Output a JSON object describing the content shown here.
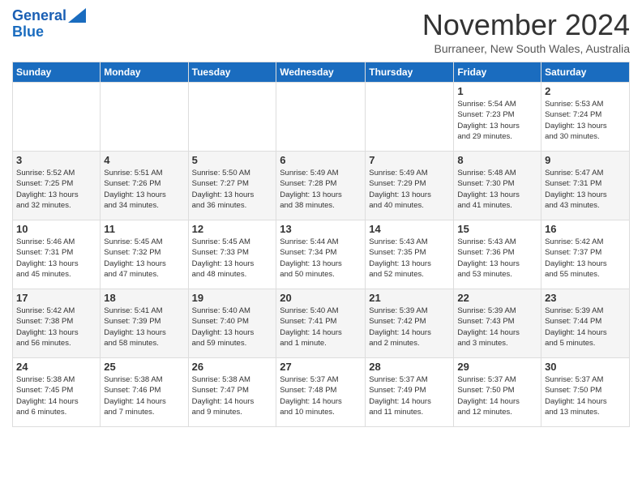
{
  "header": {
    "logo_line1": "General",
    "logo_line2": "Blue",
    "month": "November 2024",
    "location": "Burraneer, New South Wales, Australia"
  },
  "weekdays": [
    "Sunday",
    "Monday",
    "Tuesday",
    "Wednesday",
    "Thursday",
    "Friday",
    "Saturday"
  ],
  "weeks": [
    {
      "shade": false,
      "days": [
        {
          "num": "",
          "info": ""
        },
        {
          "num": "",
          "info": ""
        },
        {
          "num": "",
          "info": ""
        },
        {
          "num": "",
          "info": ""
        },
        {
          "num": "",
          "info": ""
        },
        {
          "num": "1",
          "info": "Sunrise: 5:54 AM\nSunset: 7:23 PM\nDaylight: 13 hours\nand 29 minutes."
        },
        {
          "num": "2",
          "info": "Sunrise: 5:53 AM\nSunset: 7:24 PM\nDaylight: 13 hours\nand 30 minutes."
        }
      ]
    },
    {
      "shade": true,
      "days": [
        {
          "num": "3",
          "info": "Sunrise: 5:52 AM\nSunset: 7:25 PM\nDaylight: 13 hours\nand 32 minutes."
        },
        {
          "num": "4",
          "info": "Sunrise: 5:51 AM\nSunset: 7:26 PM\nDaylight: 13 hours\nand 34 minutes."
        },
        {
          "num": "5",
          "info": "Sunrise: 5:50 AM\nSunset: 7:27 PM\nDaylight: 13 hours\nand 36 minutes."
        },
        {
          "num": "6",
          "info": "Sunrise: 5:49 AM\nSunset: 7:28 PM\nDaylight: 13 hours\nand 38 minutes."
        },
        {
          "num": "7",
          "info": "Sunrise: 5:49 AM\nSunset: 7:29 PM\nDaylight: 13 hours\nand 40 minutes."
        },
        {
          "num": "8",
          "info": "Sunrise: 5:48 AM\nSunset: 7:30 PM\nDaylight: 13 hours\nand 41 minutes."
        },
        {
          "num": "9",
          "info": "Sunrise: 5:47 AM\nSunset: 7:31 PM\nDaylight: 13 hours\nand 43 minutes."
        }
      ]
    },
    {
      "shade": false,
      "days": [
        {
          "num": "10",
          "info": "Sunrise: 5:46 AM\nSunset: 7:31 PM\nDaylight: 13 hours\nand 45 minutes."
        },
        {
          "num": "11",
          "info": "Sunrise: 5:45 AM\nSunset: 7:32 PM\nDaylight: 13 hours\nand 47 minutes."
        },
        {
          "num": "12",
          "info": "Sunrise: 5:45 AM\nSunset: 7:33 PM\nDaylight: 13 hours\nand 48 minutes."
        },
        {
          "num": "13",
          "info": "Sunrise: 5:44 AM\nSunset: 7:34 PM\nDaylight: 13 hours\nand 50 minutes."
        },
        {
          "num": "14",
          "info": "Sunrise: 5:43 AM\nSunset: 7:35 PM\nDaylight: 13 hours\nand 52 minutes."
        },
        {
          "num": "15",
          "info": "Sunrise: 5:43 AM\nSunset: 7:36 PM\nDaylight: 13 hours\nand 53 minutes."
        },
        {
          "num": "16",
          "info": "Sunrise: 5:42 AM\nSunset: 7:37 PM\nDaylight: 13 hours\nand 55 minutes."
        }
      ]
    },
    {
      "shade": true,
      "days": [
        {
          "num": "17",
          "info": "Sunrise: 5:42 AM\nSunset: 7:38 PM\nDaylight: 13 hours\nand 56 minutes."
        },
        {
          "num": "18",
          "info": "Sunrise: 5:41 AM\nSunset: 7:39 PM\nDaylight: 13 hours\nand 58 minutes."
        },
        {
          "num": "19",
          "info": "Sunrise: 5:40 AM\nSunset: 7:40 PM\nDaylight: 13 hours\nand 59 minutes."
        },
        {
          "num": "20",
          "info": "Sunrise: 5:40 AM\nSunset: 7:41 PM\nDaylight: 14 hours\nand 1 minute."
        },
        {
          "num": "21",
          "info": "Sunrise: 5:39 AM\nSunset: 7:42 PM\nDaylight: 14 hours\nand 2 minutes."
        },
        {
          "num": "22",
          "info": "Sunrise: 5:39 AM\nSunset: 7:43 PM\nDaylight: 14 hours\nand 3 minutes."
        },
        {
          "num": "23",
          "info": "Sunrise: 5:39 AM\nSunset: 7:44 PM\nDaylight: 14 hours\nand 5 minutes."
        }
      ]
    },
    {
      "shade": false,
      "days": [
        {
          "num": "24",
          "info": "Sunrise: 5:38 AM\nSunset: 7:45 PM\nDaylight: 14 hours\nand 6 minutes."
        },
        {
          "num": "25",
          "info": "Sunrise: 5:38 AM\nSunset: 7:46 PM\nDaylight: 14 hours\nand 7 minutes."
        },
        {
          "num": "26",
          "info": "Sunrise: 5:38 AM\nSunset: 7:47 PM\nDaylight: 14 hours\nand 9 minutes."
        },
        {
          "num": "27",
          "info": "Sunrise: 5:37 AM\nSunset: 7:48 PM\nDaylight: 14 hours\nand 10 minutes."
        },
        {
          "num": "28",
          "info": "Sunrise: 5:37 AM\nSunset: 7:49 PM\nDaylight: 14 hours\nand 11 minutes."
        },
        {
          "num": "29",
          "info": "Sunrise: 5:37 AM\nSunset: 7:50 PM\nDaylight: 14 hours\nand 12 minutes."
        },
        {
          "num": "30",
          "info": "Sunrise: 5:37 AM\nSunset: 7:50 PM\nDaylight: 14 hours\nand 13 minutes."
        }
      ]
    }
  ]
}
